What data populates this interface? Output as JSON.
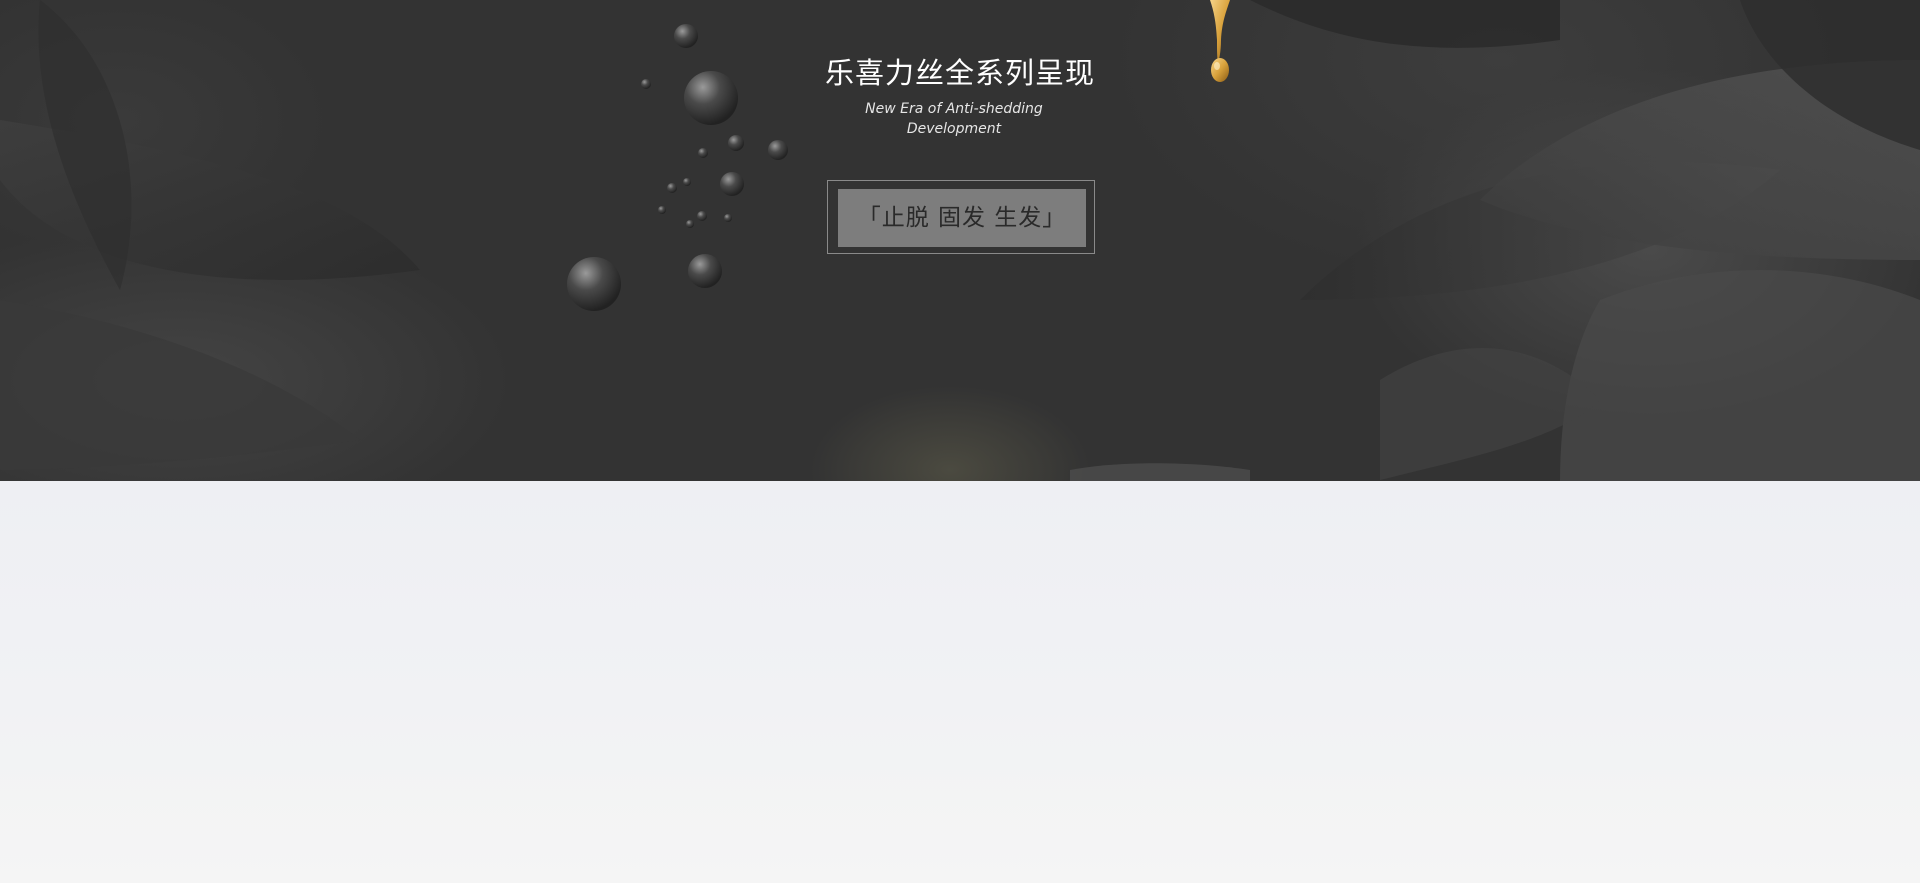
{
  "hero": {
    "title": "乐喜力丝全系列呈现",
    "subtitle": "New Era of Anti-shedding Development",
    "cta_label": "「止脱  固发  生发」"
  },
  "colors": {
    "hero_background": "#333333",
    "cta_background": "#7d7d7d",
    "content_background": "#eeeff3",
    "gold_drop": "#d9a23c"
  },
  "icons": [
    "water-droplets-decoration",
    "golden-oil-drop-icon",
    "flower-petals-background"
  ]
}
